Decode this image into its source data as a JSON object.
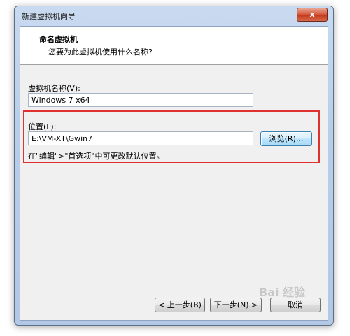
{
  "window": {
    "title": "新建虚拟机向导",
    "close_label": "x"
  },
  "header": {
    "title": "命名虚拟机",
    "subtitle": "您要为此虚拟机使用什么名称?"
  },
  "vm_name": {
    "label": "虚拟机名称(V):",
    "value": "Windows 7 x64"
  },
  "location": {
    "label": "位置(L):",
    "value": "E:\\VM-XT\\Gwin7",
    "browse_label": "浏览(R)...",
    "hint": "在\"编辑\">\"首选项\"中可更改默认位置。"
  },
  "footer": {
    "back_label": "< 上一步(B)",
    "next_label": "下一步(N) >",
    "cancel_label": "取消"
  },
  "watermark": "Bai 经验"
}
